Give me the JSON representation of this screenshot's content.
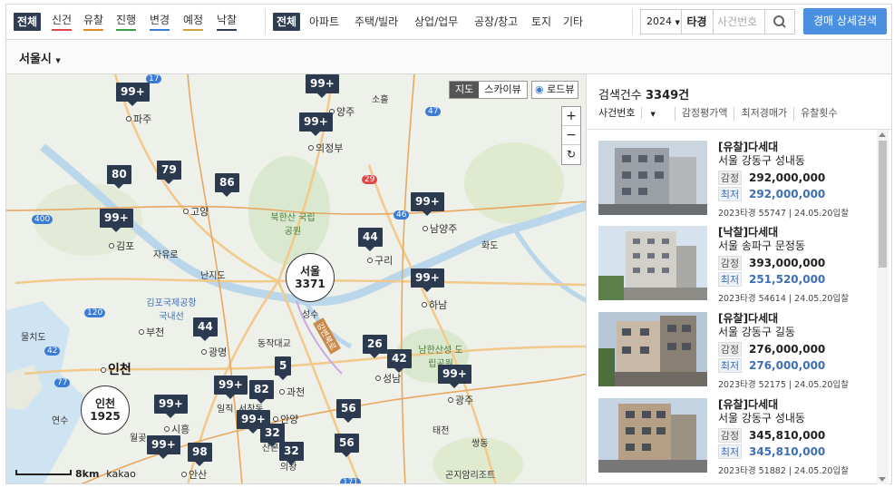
{
  "filters": {
    "status": [
      {
        "label": "전체",
        "active": true,
        "color": "#2f3d52"
      },
      {
        "label": "신건",
        "active": false,
        "color": "#e04646"
      },
      {
        "label": "유찰",
        "active": false,
        "color": "#e58b1f"
      },
      {
        "label": "진행",
        "active": false,
        "color": "#3aa045"
      },
      {
        "label": "변경",
        "active": false,
        "color": "#3a7bd5"
      },
      {
        "label": "예정",
        "active": false,
        "color": "#d1a23b"
      },
      {
        "label": "낙찰",
        "active": false,
        "color": "#2f3d52"
      }
    ],
    "types": [
      {
        "label": "전체",
        "active": true
      },
      {
        "label": "아파트"
      },
      {
        "label": "주택/빌라"
      },
      {
        "label": "상업/업무"
      },
      {
        "label": "공장/창고"
      },
      {
        "label": "토지"
      },
      {
        "label": "기타"
      }
    ],
    "year": "2024",
    "case_prefix": "타경",
    "case_placeholder": "사건번호",
    "detail_search_label": "경매 상세검색"
  },
  "region": {
    "label": "서울시"
  },
  "map": {
    "types": [
      "지도",
      "스카이뷰"
    ],
    "active_type": "지도",
    "roadview_label": "로드뷰",
    "scale_label": "8km",
    "brand": "kakao",
    "markers": [
      "99+",
      "99+",
      "99+",
      "80",
      "79",
      "86",
      "99+",
      "99+",
      "44",
      "99+",
      "44",
      "26",
      "42",
      "5",
      "99+",
      "99+",
      "82",
      "99+",
      "56",
      "99+",
      "32",
      "98",
      "32",
      "56",
      "99+"
    ],
    "clusters": [
      {
        "name": "서울",
        "count": "3371"
      },
      {
        "name": "인천",
        "count": "1925"
      }
    ],
    "places": [
      "파주",
      "양주",
      "의정부",
      "고양",
      "남양주",
      "김포",
      "구리",
      "하남",
      "부천",
      "광명",
      "인천",
      "과천",
      "성남",
      "광주",
      "시흥",
      "안양",
      "안산",
      "북한산 국립공원",
      "남한산성 도립공원",
      "곤지암리조트",
      "소흘",
      "화도",
      "자유로",
      "난지도",
      "김포국제공항 국내선",
      "동작대교",
      "성수",
      "강변북로",
      "연수",
      "물치도",
      "태전",
      "쌍동",
      "월곶",
      "산본",
      "일직",
      "서창동",
      "의왕"
    ],
    "route_badges": [
      "17",
      "47",
      "29",
      "46",
      "400",
      "120",
      "42",
      "77",
      "171"
    ]
  },
  "panel": {
    "count_label": "검색건수",
    "count_value": "3349건",
    "sorts": [
      "사건번호",
      "감정평가액",
      "최저경매가",
      "유찰횟수"
    ],
    "appraisal_tag": "감정",
    "min_tag": "최저",
    "listings": [
      {
        "title": "[유찰]다세대",
        "address": "서울 강동구 성내동",
        "appraisal": "292,000,000",
        "minimum": "292,000,000",
        "case": "2023타경 55747",
        "date": "24.05.20입찰"
      },
      {
        "title": "[낙찰]다세대",
        "address": "서울 송파구 문정동",
        "appraisal": "393,000,000",
        "minimum": "251,520,000",
        "case": "2023타경 54614",
        "date": "24.05.20입찰"
      },
      {
        "title": "[유찰]다세대",
        "address": "서울 강동구 길동",
        "appraisal": "276,000,000",
        "minimum": "276,000,000",
        "case": "2023타경 52175",
        "date": "24.05.20입찰"
      },
      {
        "title": "[유찰]다세대",
        "address": "서울 강동구 성내동",
        "appraisal": "345,810,000",
        "minimum": "345,810,000",
        "case": "2023타경 51882",
        "date": "24.05.20입찰"
      }
    ]
  }
}
